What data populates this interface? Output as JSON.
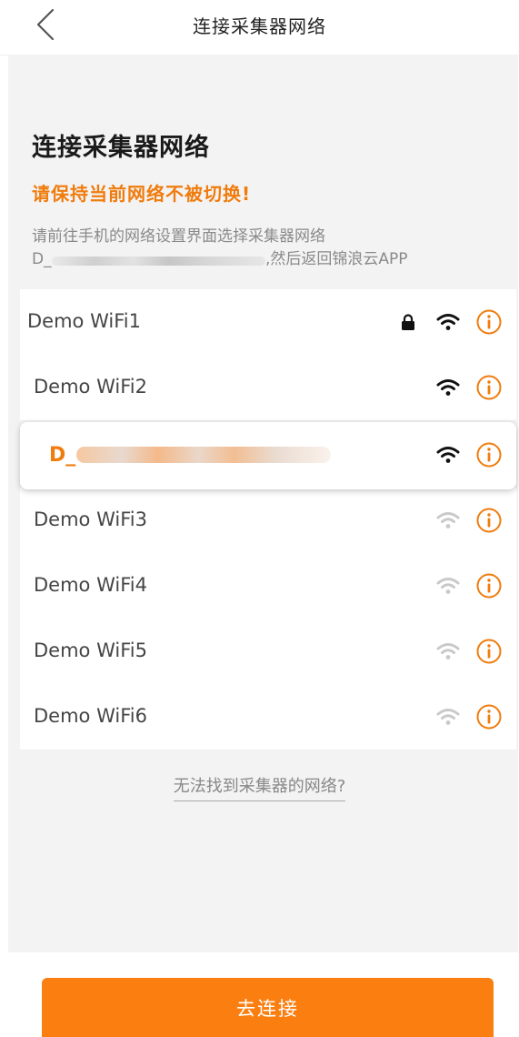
{
  "header": {
    "title": "连接采集器网络",
    "back_icon": "chevron-left-icon"
  },
  "main": {
    "title": "连接采集器网络",
    "warning": "请保持当前网络不被切换!",
    "instruction_line1": "请前往手机的网络设置界面选择采集器网络",
    "instruction_prefix": "D_",
    "instruction_suffix": ",然后返回锦浪云APP"
  },
  "wifi_list": [
    {
      "name": "Demo WiFi1",
      "locked": true,
      "signal": "strong",
      "selected": false
    },
    {
      "name": "Demo WiFi2",
      "locked": false,
      "signal": "strong",
      "selected": false
    },
    {
      "name": "D_",
      "locked": false,
      "signal": "strong",
      "selected": true
    },
    {
      "name": "Demo WiFi3",
      "locked": false,
      "signal": "weak",
      "selected": false
    },
    {
      "name": "Demo WiFi4",
      "locked": false,
      "signal": "weak",
      "selected": false
    },
    {
      "name": "Demo WiFi5",
      "locked": false,
      "signal": "weak",
      "selected": false
    },
    {
      "name": "Demo WiFi6",
      "locked": false,
      "signal": "weak",
      "selected": false
    }
  ],
  "help_link": "无法找到采集器的网络?",
  "connect_button": "去连接",
  "colors": {
    "accent": "#f07c0e",
    "button": "#fb7e10",
    "background": "#f3f3f3",
    "wifi_strong": "#111111",
    "wifi_weak": "#c9c9c9"
  }
}
